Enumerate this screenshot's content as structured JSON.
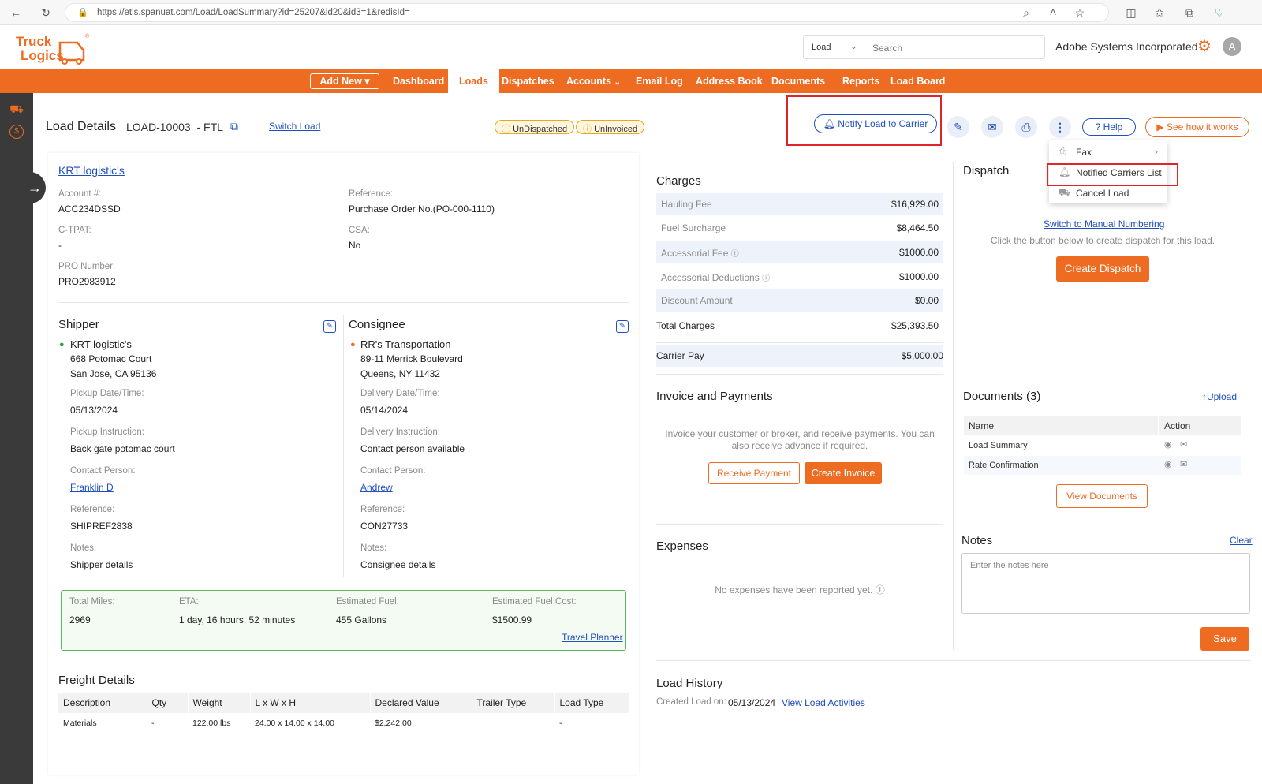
{
  "browser": {
    "url": "https://etls.spanuat.com/Load/LoadSummary?id=25207&id20&id3=1&redisId=",
    "icons": [
      "back-icon",
      "refresh-icon",
      "site-info-icon",
      "zoom-icon",
      "read-aloud-icon",
      "favorite-icon",
      "split-screen-icon",
      "favorites-bar-icon",
      "collections-icon",
      "browser-essentials-icon"
    ]
  },
  "header": {
    "logo_text": "Truck Logics",
    "search_type": "Load",
    "search_placeholder": "Search",
    "company": "Adobe Systems Incorporated",
    "avatar_initial": "A"
  },
  "nav": {
    "add_new": "Add New",
    "items": [
      "Dashboard",
      "Loads",
      "Dispatches",
      "Accounts",
      "Email Log",
      "Address Book",
      "Documents",
      "Reports",
      "Load Board"
    ],
    "active": "Loads"
  },
  "titlebar": {
    "title": "Load Details",
    "load_id": "LOAD-10003",
    "load_type": "- FTL",
    "switch_load": "Switch Load",
    "badges": [
      "UnDispatched",
      "UnInvoiced"
    ],
    "notify": "Notify Load to Carrier",
    "help": "Help",
    "see_how": "See how it works"
  },
  "menu": {
    "items": [
      "Fax",
      "Notified Carriers List",
      "Cancel Load"
    ]
  },
  "customer": {
    "name": "KRT logistic's",
    "fields": [
      {
        "label": "Account #:",
        "value": "ACC234DSSD"
      },
      {
        "label": "Reference:",
        "value": "Purchase Order No.(PO-000-1110)"
      },
      {
        "label": "C-TPAT:",
        "value": "-"
      },
      {
        "label": "CSA:",
        "value": "No"
      },
      {
        "label": "PRO Number:",
        "value": "PRO2983912"
      }
    ]
  },
  "shipper": {
    "heading": "Shipper",
    "name": "KRT logistic's",
    "address1": "668 Potomac Court",
    "address2": "San Jose, CA 95136",
    "date_label": "Pickup Date/Time:",
    "date": "05/13/2024",
    "instr_label": "Pickup Instruction:",
    "instr": "Back gate potomac court",
    "contact_label": "Contact Person:",
    "contact": "Franklin D",
    "ref_label": "Reference:",
    "ref": "SHIPREF2838",
    "notes_label": "Notes:",
    "notes": "Shipper details"
  },
  "consignee": {
    "heading": "Consignee",
    "name": "RR's Transportation",
    "address1": "89-11 Merrick Boulevard",
    "address2": "Queens, NY 11432",
    "date_label": "Delivery Date/Time:",
    "date": "05/14/2024",
    "instr_label": "Delivery Instruction:",
    "instr": "Contact person available",
    "contact_label": "Contact Person:",
    "contact": "Andrew",
    "ref_label": "Reference:",
    "ref": "CON27733",
    "notes_label": "Notes:",
    "notes": "Consignee details"
  },
  "trip": {
    "miles_label": "Total Miles:",
    "miles": "2969",
    "eta_label": "ETA:",
    "eta": "1 day, 16 hours, 52 minutes",
    "fuel_label": "Estimated Fuel:",
    "fuel": "455 Gallons",
    "cost_label": "Estimated Fuel Cost:",
    "cost": "$1500.99",
    "planner": "Travel Planner"
  },
  "freight": {
    "heading": "Freight Details",
    "columns": [
      "Description",
      "Qty",
      "Weight",
      "L x W x H",
      "Declared Value",
      "Trailer Type",
      "Load Type"
    ],
    "rows": [
      [
        "Materials",
        "-",
        "122.00 lbs",
        "24.00 x 14.00 x 14.00",
        "$2,242.00",
        "",
        "-"
      ]
    ]
  },
  "charges": {
    "heading": "Charges",
    "rows": [
      {
        "name": "Hauling Fee",
        "value": "$16,929.00"
      },
      {
        "name": "Fuel Surcharge",
        "value": "$8,464.50"
      },
      {
        "name": "Accessorial Fee",
        "value": "$1000.00"
      },
      {
        "name": "Accessorial Deductions",
        "value": "$1000.00"
      },
      {
        "name": "Discount Amount",
        "value": "$0.00"
      }
    ],
    "total_label": "Total Charges",
    "total": "$25,393.50",
    "carrier_label": "Carrier Pay",
    "carrier": "$5,000.00"
  },
  "invoice": {
    "heading": "Invoice and Payments",
    "text": "Invoice your customer or broker, and receive payments. You can also receive advance if required.",
    "receive": "Receive Payment",
    "create": "Create Invoice"
  },
  "expenses": {
    "heading": "Expenses",
    "empty": "No expenses have been reported yet."
  },
  "history": {
    "heading": "Load History",
    "created_label": "Created Load on:",
    "created": "05/13/2024",
    "view": "View Load Activities"
  },
  "dispatch": {
    "heading": "Dispatch",
    "manual": "Switch to Manual Numbering",
    "hint": "Click the button below to create dispatch for this load.",
    "create": "Create Dispatch"
  },
  "documents": {
    "heading": "Documents (3)",
    "upload": "Upload",
    "columns": [
      "Name",
      "Action"
    ],
    "rows": [
      "Load Summary",
      "Rate Confirmation"
    ],
    "view": "View Documents"
  },
  "notes": {
    "heading": "Notes",
    "clear": "Clear",
    "placeholder": "Enter the notes here",
    "save": "Save"
  },
  "colors": {
    "accent": "#ee6b22",
    "link": "#1f4fbf",
    "highlight": "#e0242a",
    "rail": "#3a3a3a"
  }
}
